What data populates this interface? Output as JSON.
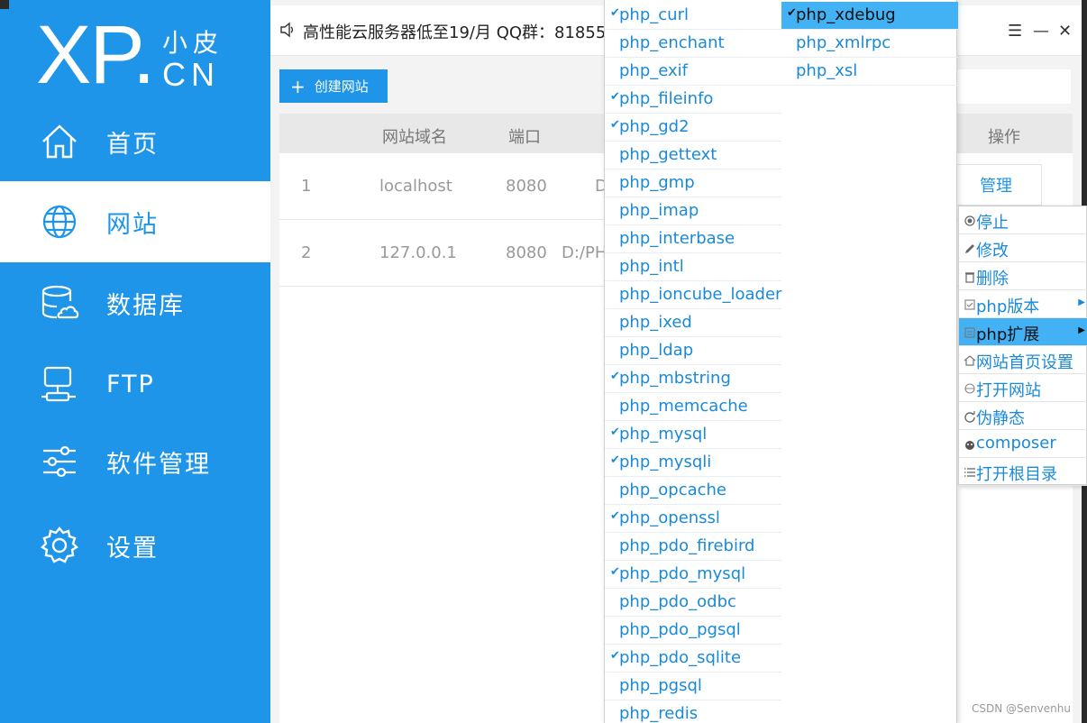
{
  "logo": {
    "big": "XP.",
    "small_top": "小皮",
    "small_bottom": "CN"
  },
  "sidebar": {
    "items": [
      {
        "label": "首页",
        "icon": "home-icon",
        "active": false
      },
      {
        "label": "网站",
        "icon": "globe-icon",
        "active": true
      },
      {
        "label": "数据库",
        "icon": "database-icon",
        "active": false
      },
      {
        "label": "FTP",
        "icon": "server-icon",
        "active": false
      },
      {
        "label": "软件管理",
        "icon": "sliders-icon",
        "active": false
      },
      {
        "label": "设置",
        "icon": "gear-icon",
        "active": false
      }
    ]
  },
  "topbar": {
    "notice": "高性能云服务器低至19/月  QQ群：81855",
    "menu_icon": "☰",
    "minimize": "—",
    "close": "✕"
  },
  "toolbar": {
    "create_label": "创建网站",
    "create_icon": "+"
  },
  "table": {
    "headers": {
      "domain": "网站域名",
      "port": "端口",
      "actions": "操作"
    },
    "rows": [
      {
        "index": "1",
        "domain": "localhost",
        "port": "8080",
        "path": "D",
        "manage": "管理"
      },
      {
        "index": "2",
        "domain": "127.0.0.1",
        "port": "8080",
        "path": "D:/PH"
      }
    ]
  },
  "extensions": {
    "column1": [
      {
        "name": "php_curl",
        "checked": true
      },
      {
        "name": "php_enchant",
        "checked": false
      },
      {
        "name": "php_exif",
        "checked": false
      },
      {
        "name": "php_fileinfo",
        "checked": true
      },
      {
        "name": "php_gd2",
        "checked": true
      },
      {
        "name": "php_gettext",
        "checked": false
      },
      {
        "name": "php_gmp",
        "checked": false
      },
      {
        "name": "php_imap",
        "checked": false
      },
      {
        "name": "php_interbase",
        "checked": false
      },
      {
        "name": "php_intl",
        "checked": false
      },
      {
        "name": "php_ioncube_loader",
        "checked": false
      },
      {
        "name": "php_ixed",
        "checked": false
      },
      {
        "name": "php_ldap",
        "checked": false
      },
      {
        "name": "php_mbstring",
        "checked": true
      },
      {
        "name": "php_memcache",
        "checked": false
      },
      {
        "name": "php_mysql",
        "checked": true
      },
      {
        "name": "php_mysqli",
        "checked": true
      },
      {
        "name": "php_opcache",
        "checked": false
      },
      {
        "name": "php_openssl",
        "checked": true
      },
      {
        "name": "php_pdo_firebird",
        "checked": false
      },
      {
        "name": "php_pdo_mysql",
        "checked": true
      },
      {
        "name": "php_pdo_odbc",
        "checked": false
      },
      {
        "name": "php_pdo_pgsql",
        "checked": false
      },
      {
        "name": "php_pdo_sqlite",
        "checked": true
      },
      {
        "name": "php_pgsql",
        "checked": false
      },
      {
        "name": "php_redis",
        "checked": false
      }
    ],
    "column2": [
      {
        "name": "php_xdebug",
        "checked": true,
        "highlighted": true
      },
      {
        "name": "php_xmlrpc",
        "checked": false
      },
      {
        "name": "php_xsl",
        "checked": false
      }
    ],
    "check_mark": "✔"
  },
  "context_menu": {
    "items": [
      {
        "label": "停止",
        "icon": "stop-icon",
        "submenu": false
      },
      {
        "label": "修改",
        "icon": "edit-icon",
        "submenu": false
      },
      {
        "label": "删除",
        "icon": "trash-icon",
        "submenu": false
      },
      {
        "label": "php版本",
        "icon": "version-icon",
        "submenu": true
      },
      {
        "label": "php扩展",
        "icon": "extension-icon",
        "submenu": true,
        "highlighted": true
      },
      {
        "label": "网站首页设置",
        "icon": "home-small-icon",
        "submenu": false
      },
      {
        "label": "打开网站",
        "icon": "globe-small-icon",
        "submenu": false
      },
      {
        "label": "伪静态",
        "icon": "refresh-icon",
        "submenu": false
      },
      {
        "label": "composer",
        "icon": "composer-icon",
        "submenu": false
      },
      {
        "label": "打开根目录",
        "icon": "list-icon",
        "submenu": false
      }
    ],
    "arrow": "▶"
  },
  "watermark": "CSDN @Senvenhu",
  "colors": {
    "accent": "#1e95e8",
    "highlight": "#42b2f5",
    "link": "#1a8ad8"
  }
}
